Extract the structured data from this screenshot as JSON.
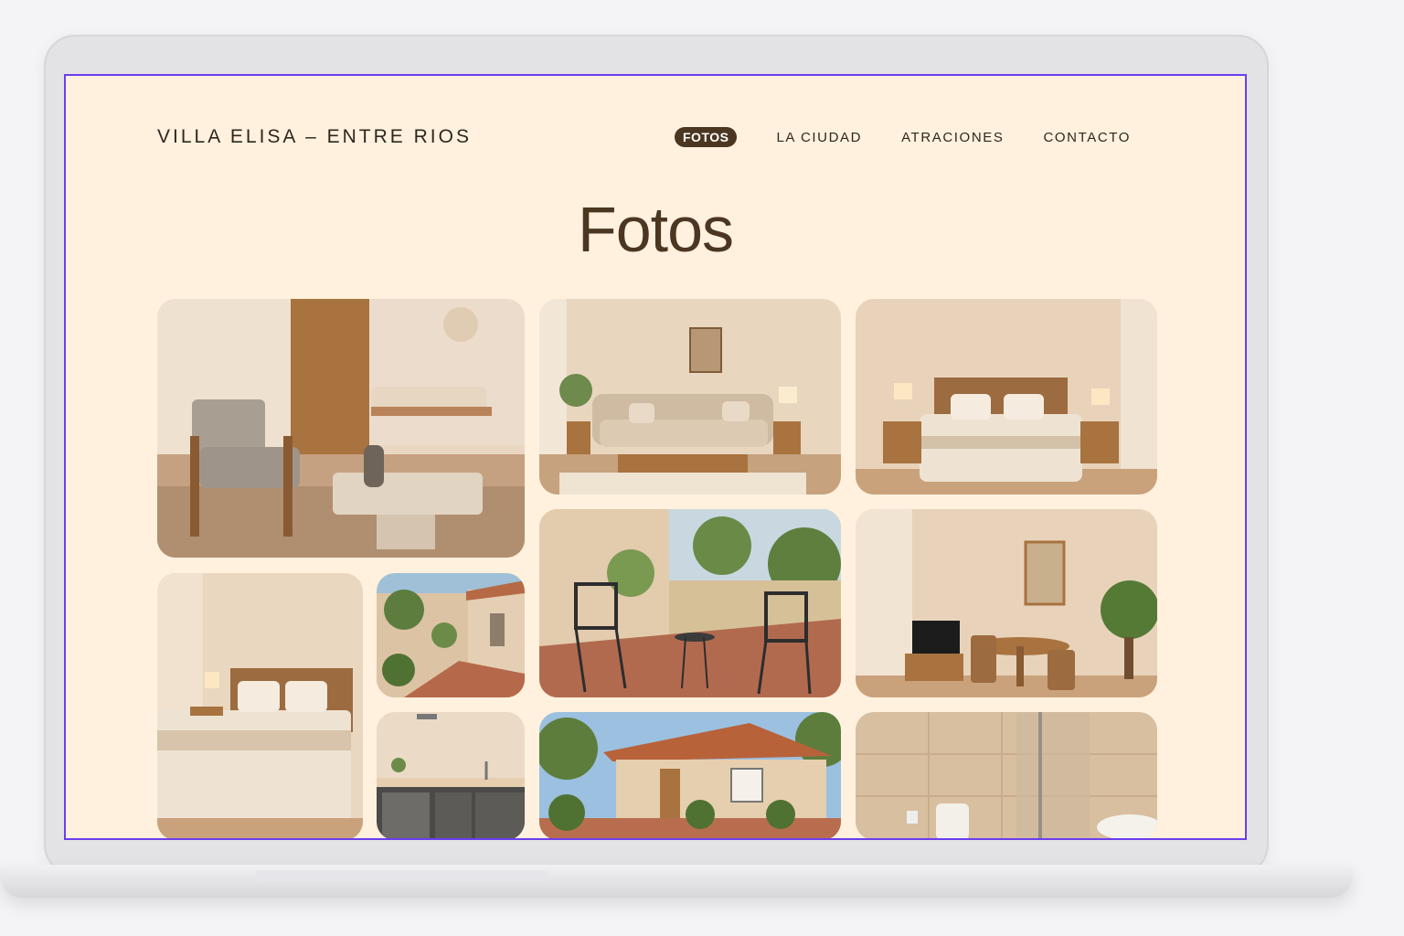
{
  "site": {
    "brand": "VILLA ELISA – ENTRE RIOS"
  },
  "nav": {
    "items": [
      {
        "label": "FOTOS",
        "active": true
      },
      {
        "label": "LA CIUDAD",
        "active": false
      },
      {
        "label": "ATRACIONES",
        "active": false
      },
      {
        "label": "CONTACTO",
        "active": false
      }
    ]
  },
  "page": {
    "title": "Fotos"
  },
  "gallery": {
    "photos": [
      {
        "subject": "living-room-armchair"
      },
      {
        "subject": "living-room-sofa"
      },
      {
        "subject": "bedroom-double-bed"
      },
      {
        "subject": "bedroom-lamp"
      },
      {
        "subject": "courtyard-path"
      },
      {
        "subject": "patio-chairs"
      },
      {
        "subject": "dining-room"
      },
      {
        "subject": "kitchenette"
      },
      {
        "subject": "house-exterior"
      },
      {
        "subject": "bathroom"
      }
    ]
  },
  "colors": {
    "background": "#fff1dd",
    "accent": "#4b3622",
    "text": "#2e261f",
    "frame": "#6c3df0"
  }
}
